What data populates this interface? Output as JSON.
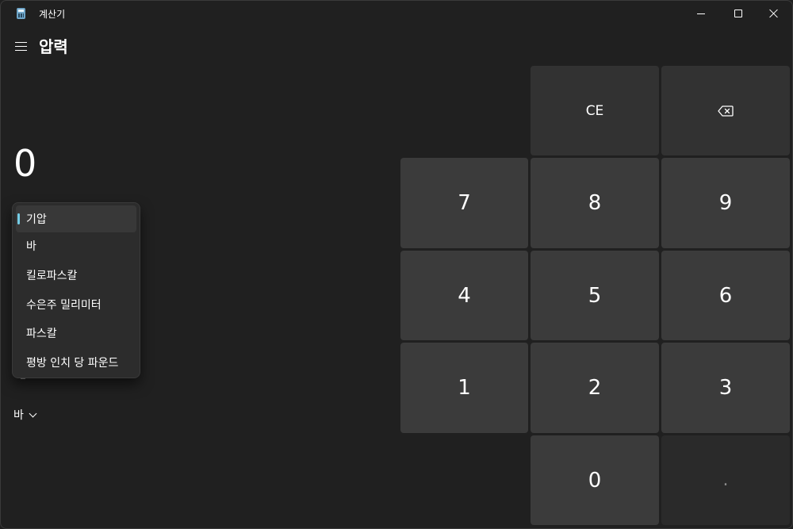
{
  "window": {
    "title": "계산기"
  },
  "header": {
    "mode_title": "압력"
  },
  "display": {
    "value": "0"
  },
  "unit_dropdown": {
    "items": [
      {
        "label": "기압",
        "selected": true
      },
      {
        "label": "바",
        "selected": false
      },
      {
        "label": "킬로파스칼",
        "selected": false
      },
      {
        "label": "수은주 밀리미터",
        "selected": false
      },
      {
        "label": "파스칼",
        "selected": false
      },
      {
        "label": "평방 인치 당 파운드",
        "selected": false
      }
    ]
  },
  "target_unit": {
    "label": "바"
  },
  "keypad": {
    "ce": "CE",
    "backspace_icon": "backspace-icon",
    "seven": "7",
    "eight": "8",
    "nine": "9",
    "four": "4",
    "five": "5",
    "six": "6",
    "one": "1",
    "two": "2",
    "three": "3",
    "zero": "0",
    "decimal": "."
  },
  "colors": {
    "background": "#202020",
    "key": "#3b3b3b",
    "key_util": "#323232",
    "accent": "#74cde6"
  }
}
